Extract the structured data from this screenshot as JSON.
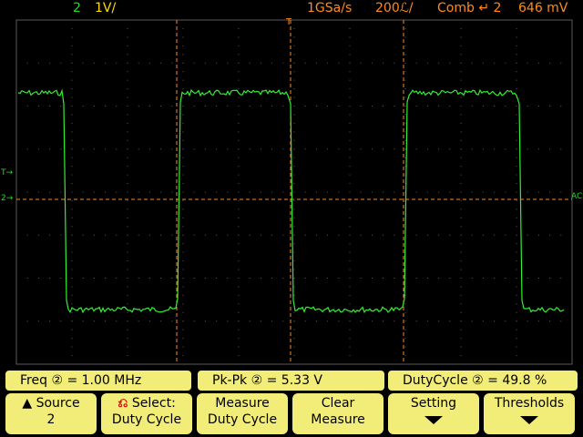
{
  "status_bar": {
    "channel": "2",
    "vertical_scale": "1V/",
    "sample_rate": "1GSa/s",
    "timebase": "200ℒ/",
    "trigger_mode": "Comb",
    "trigger_slope_icon": "rising-edge-icon",
    "trigger_source": "2",
    "trigger_level": "646 mV"
  },
  "markers": {
    "trigger_position_icon": "T",
    "trigger_level_marker": "T→",
    "ground_marker": "2→",
    "coupling_label": "AC"
  },
  "measurements": {
    "freq_label": "Freq",
    "freq_channel": "②",
    "freq_value": "= 1.00 MHz",
    "pkpk_label": "Pk-Pk",
    "pkpk_channel": "②",
    "pkpk_value": "= 5.33 V",
    "duty_label": "DutyCycle",
    "duty_channel": "②",
    "duty_value": "= 49.8 %"
  },
  "softkeys": {
    "source_l1": "Source",
    "source_l2": "2",
    "select_l1": "Select:",
    "select_l2": "Duty Cycle",
    "measure_l1": "Measure",
    "measure_l2": "Duty Cycle",
    "clear_l1": "Clear",
    "clear_l2": "Measure",
    "setting_l1": "Setting",
    "thresholds_l1": "Thresholds"
  },
  "colors": {
    "trace": "#33ee33",
    "grid": "#5a5a5a",
    "cursor": "#ff8a1e",
    "softkey_bg": "#f2ec78"
  }
}
